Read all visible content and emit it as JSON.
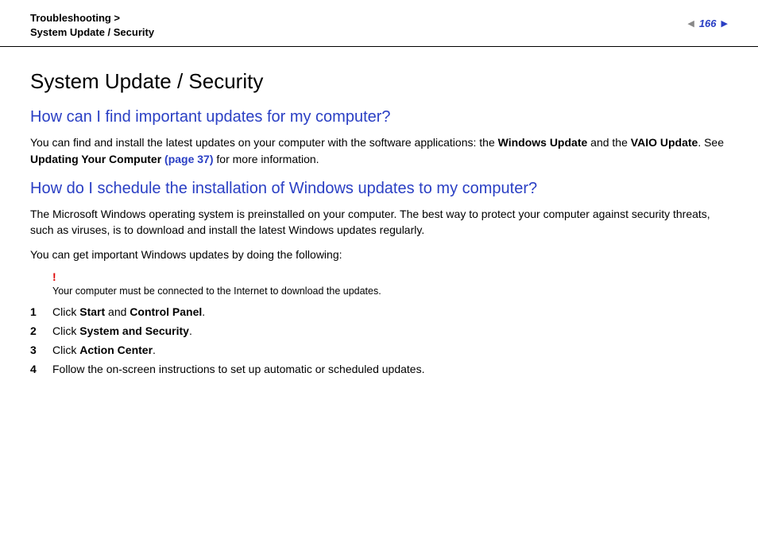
{
  "header": {
    "breadcrumb_line1": "Troubleshooting >",
    "breadcrumb_line2": "System Update / Security",
    "page_number": "166"
  },
  "content": {
    "title": "System Update / Security",
    "section1": {
      "heading": "How can I find important updates for my computer?",
      "para1_a": "You can find and install the latest updates on your computer with the software applications: the ",
      "para1_b": "Windows Update",
      "para1_c": " and the ",
      "para1_d": "VAIO Update",
      "para1_e": ". See ",
      "para1_f": "Updating Your Computer ",
      "para1_g": "(page 37)",
      "para1_h": " for more information."
    },
    "section2": {
      "heading": "How do I schedule the installation of Windows updates to my computer?",
      "para1": "The Microsoft Windows operating system is preinstalled on your computer. The best way to protect your computer against security threats, such as viruses, is to download and install the latest Windows updates regularly.",
      "para2": "You can get important Windows updates by doing the following:",
      "alert_mark": "!",
      "alert_text": "Your computer must be connected to the Internet to download the updates.",
      "steps": [
        {
          "num": "1",
          "prefix": "Click ",
          "bold1": "Start",
          "mid": " and ",
          "bold2": "Control Panel",
          "suffix": "."
        },
        {
          "num": "2",
          "prefix": "Click ",
          "bold1": "System and Security",
          "mid": "",
          "bold2": "",
          "suffix": "."
        },
        {
          "num": "3",
          "prefix": "Click ",
          "bold1": "Action Center",
          "mid": "",
          "bold2": "",
          "suffix": "."
        },
        {
          "num": "4",
          "prefix": "Follow the on-screen instructions to set up automatic or scheduled updates.",
          "bold1": "",
          "mid": "",
          "bold2": "",
          "suffix": ""
        }
      ]
    }
  }
}
